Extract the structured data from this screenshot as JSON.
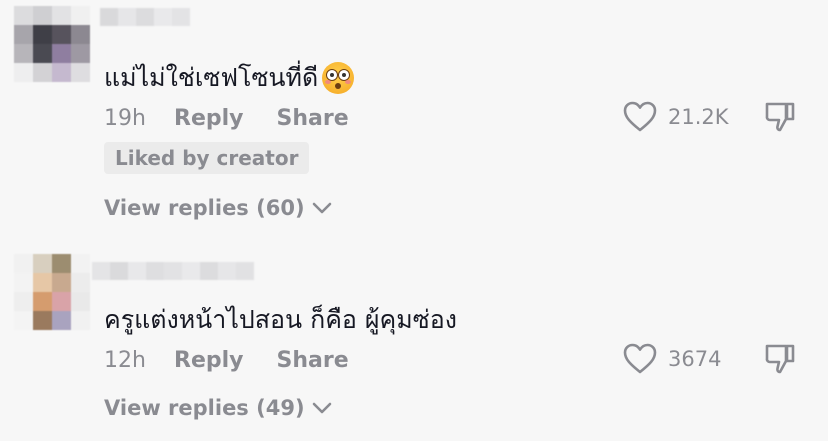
{
  "comments": [
    {
      "text": "แม่ไม่ใช่เซฟโซนที่ดี",
      "emoji": "flushed-face",
      "time": "19h",
      "reply_label": "Reply",
      "share_label": "Share",
      "likes": "21.2K",
      "badge": "Liked by creator",
      "view_replies": "View replies (60)"
    },
    {
      "text": "ครูแต่งหน้าไปสอน ก็คือ ผู้คุมซ่อง",
      "time": "12h",
      "reply_label": "Reply",
      "share_label": "Share",
      "likes": "3674",
      "view_replies": "View replies (49)"
    }
  ],
  "icons": {
    "like": "heart-outline-icon",
    "dislike": "thumbs-down-icon",
    "expand": "chevron-down-icon"
  },
  "colors": {
    "background": "#f7f7f7",
    "text_primary": "#161823",
    "text_secondary": "#8a8b91",
    "badge_bg": "#ebebeb"
  }
}
